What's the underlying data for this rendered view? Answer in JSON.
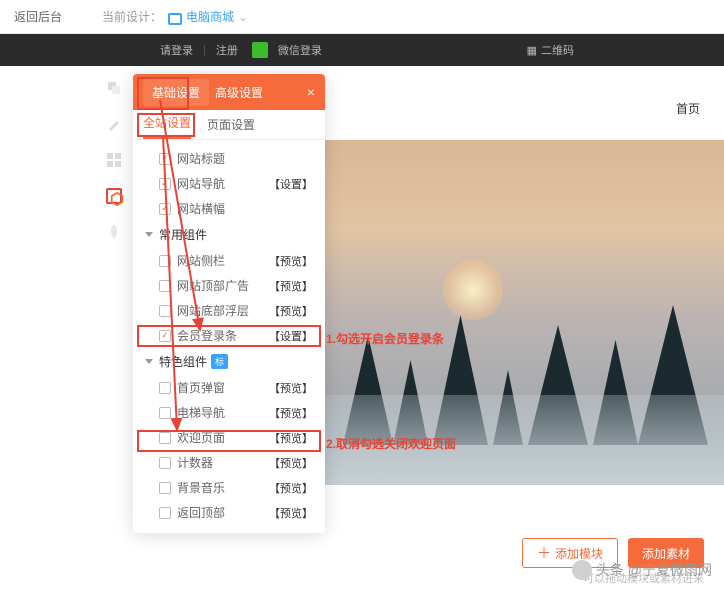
{
  "topbar": {
    "back": "返回后台",
    "label": "当前设计：",
    "dropdown": "电脑商城"
  },
  "darkbar": {
    "login": "请登录",
    "register": "注册",
    "wechat": "微信登录",
    "qrcode": "二维码"
  },
  "nav": {
    "home": "首页"
  },
  "panel": {
    "tab_basic": "基础设置",
    "tab_adv": "高级设置",
    "subtab_site": "全站设置",
    "subtab_page": "页面设置",
    "group_common": "常用组件",
    "group_special": "特色组件",
    "rows": {
      "title": "网站标题",
      "nav": "网站导航",
      "nav_act": "【设置】",
      "banner": "网站横幅",
      "sidebar": "网站侧栏",
      "sidebar_act": "【预览】",
      "topad": "网站顶部广告",
      "topad_act": "【预览】",
      "bottomfloat": "网站底部浮层",
      "bottomfloat_act": "【预览】",
      "loginbar": "会员登录条",
      "loginbar_act": "【设置】",
      "popup": "首页弹窗",
      "popup_act": "【预览】",
      "elevator": "电梯导航",
      "elevator_act": "【预览】",
      "welcome": "欢迎页面",
      "welcome_act": "【预览】",
      "counter": "计数器",
      "counter_act": "【预览】",
      "bgm": "背景音乐",
      "bgm_act": "【预览】",
      "backtop": "返回顶部",
      "backtop_act": "【预览】"
    },
    "badge": "标"
  },
  "annotations": {
    "a1": "1.勾选开启会员登录条",
    "a2": "2.取消勾选关闭欢迎页面"
  },
  "bottom": {
    "add_module": "添加模块",
    "add_material": "添加素材",
    "hint": "可以拖动模块或素材进来"
  },
  "watermark": "头条 @宁夏微雨网"
}
